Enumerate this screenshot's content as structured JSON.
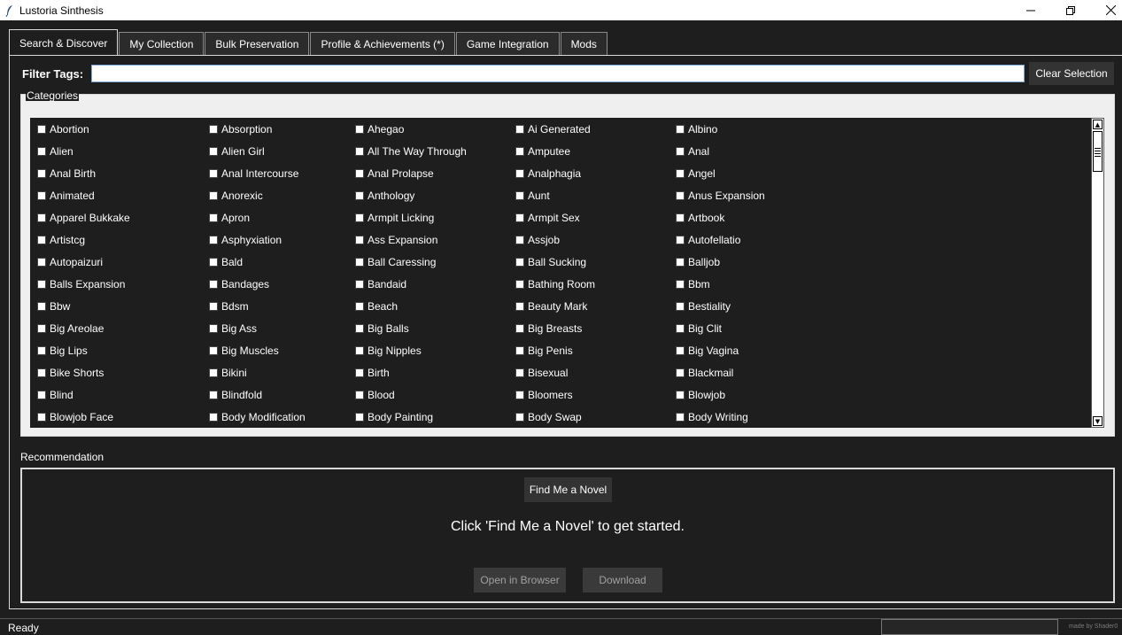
{
  "window": {
    "title": "Lustoria Sinthesis"
  },
  "tabs": [
    {
      "label": "Search & Discover",
      "active": true
    },
    {
      "label": "My Collection"
    },
    {
      "label": "Bulk Preservation"
    },
    {
      "label": "Profile & Achievements (*)"
    },
    {
      "label": "Game Integration"
    },
    {
      "label": "Mods"
    }
  ],
  "filter": {
    "label": "Filter Tags:",
    "value": "",
    "clear_label": "Clear Selection"
  },
  "categories": {
    "label": "Categories",
    "items": [
      [
        "Abortion",
        "Absorption",
        "Ahegao",
        "Ai Generated",
        "Albino"
      ],
      [
        "Alien",
        "Alien Girl",
        "All The Way Through",
        "Amputee",
        "Anal"
      ],
      [
        "Anal Birth",
        "Anal Intercourse",
        "Anal Prolapse",
        "Analphagia",
        "Angel"
      ],
      [
        "Animated",
        "Anorexic",
        "Anthology",
        "Aunt",
        "Anus Expansion"
      ],
      [
        "Apparel Bukkake",
        "Apron",
        "Armpit Licking",
        "Armpit Sex",
        "Artbook"
      ],
      [
        "Artistcg",
        "Asphyxiation",
        "Ass Expansion",
        "Assjob",
        "Autofellatio"
      ],
      [
        "Autopaizuri",
        "Bald",
        "Ball Caressing",
        "Ball Sucking",
        "Balljob"
      ],
      [
        "Balls Expansion",
        "Bandages",
        "Bandaid",
        "Bathing Room",
        "Bbm"
      ],
      [
        "Bbw",
        "Bdsm",
        "Beach",
        "Beauty Mark",
        "Bestiality"
      ],
      [
        "Big Areolae",
        "Big Ass",
        "Big Balls",
        "Big Breasts",
        "Big Clit"
      ],
      [
        "Big Lips",
        "Big Muscles",
        "Big Nipples",
        "Big Penis",
        "Big Vagina"
      ],
      [
        "Bike Shorts",
        "Bikini",
        "Birth",
        "Bisexual",
        "Blackmail"
      ],
      [
        "Blind",
        "Blindfold",
        "Blood",
        "Bloomers",
        "Blowjob"
      ],
      [
        "Blowjob Face",
        "Body Modification",
        "Body Painting",
        "Body Swap",
        "Body Writing"
      ]
    ]
  },
  "recommendation": {
    "label": "Recommendation",
    "find_label": "Find Me a Novel",
    "message": "Click 'Find Me a Novel' to get started.",
    "open_label": "Open in Browser",
    "download_label": "Download"
  },
  "status": {
    "text": "Ready",
    "credit": "made by Shader0"
  }
}
